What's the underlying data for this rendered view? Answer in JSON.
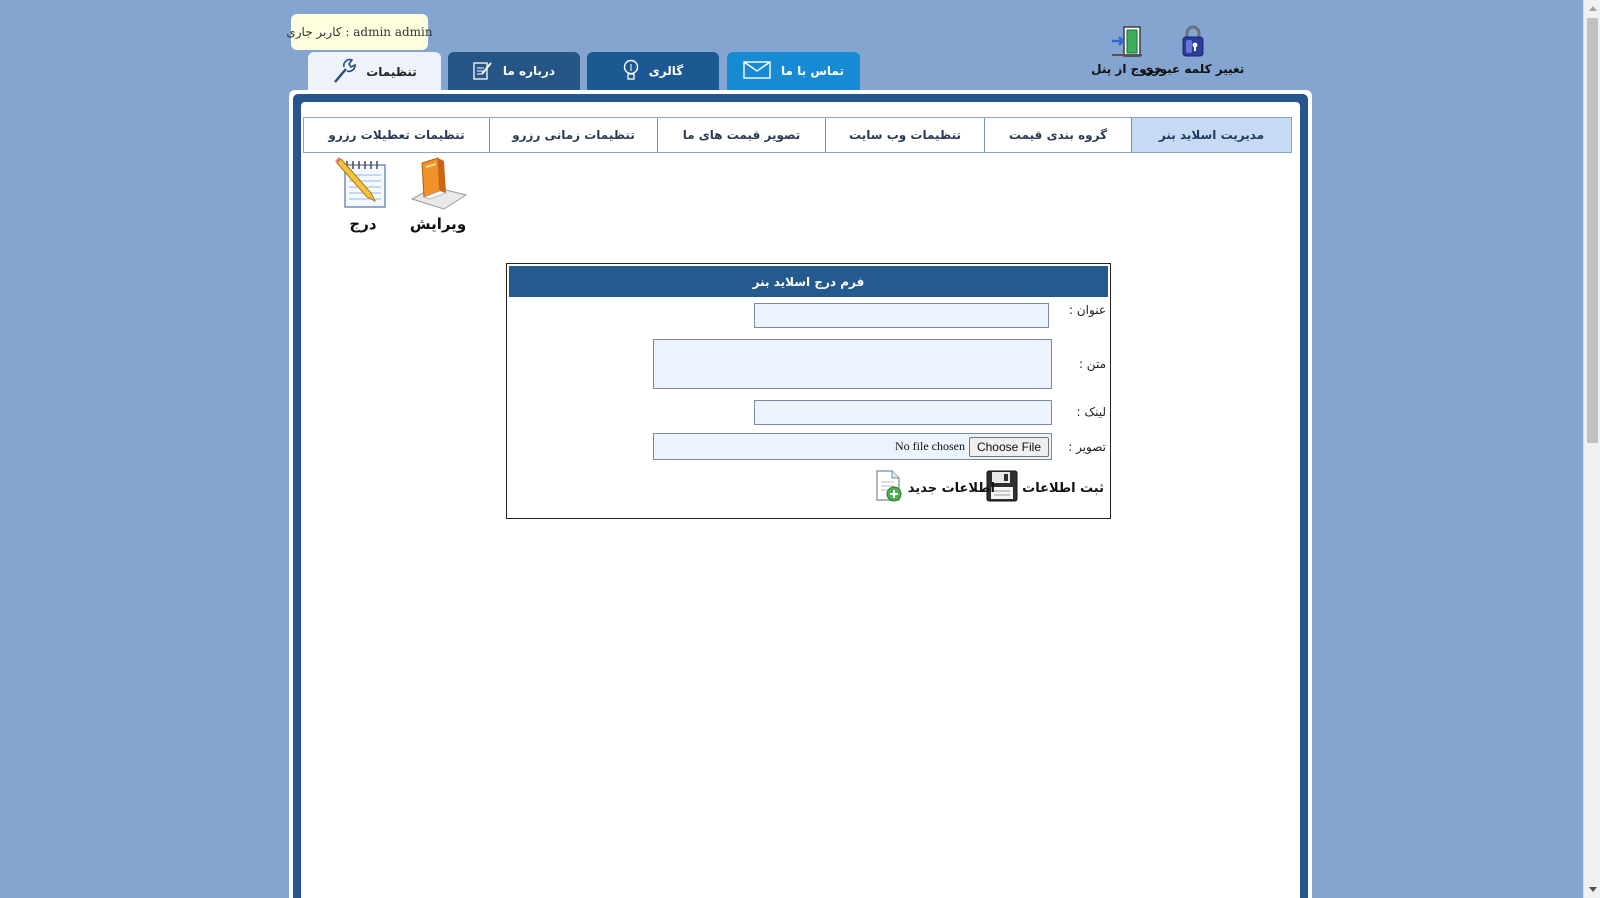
{
  "current_user": "admin admin : کاربر جاری",
  "top_actions": {
    "change_password": "تغییر کلمه عبوری",
    "exit_panel": "خروج از پنل"
  },
  "main_tabs": {
    "contact": "تماس با ما",
    "gallery": "گالری",
    "about": "درباره ما",
    "settings": "تنظیمات"
  },
  "sub_tabs": [
    "مدیریت اسلاید بنر",
    "گروه بندی قیمت",
    "تنظیمات وب سایت",
    "تصویر قیمت های ما",
    "تنظیمات زمانی رزرو",
    "تنظیمات تعطیلات رزرو"
  ],
  "tools": {
    "edit": "ویرایش",
    "insert": "درج"
  },
  "form": {
    "title": "فرم درج اسلاید بنر",
    "title_label": "عنوان :",
    "text_label": "متن :",
    "link_label": "لینک :",
    "image_label": "تصویر :",
    "title_value": "",
    "text_value": "",
    "link_value": "",
    "choose_file": "Choose File",
    "no_file": "No file chosen",
    "submit": "ثبت اطلاعات",
    "new_info": "اطلاعات جدید"
  },
  "colors": {
    "page_bg": "#84a5d0",
    "tab_dark": "#255d92",
    "tab_contact": "#168ad2",
    "header_blue": "#245a8d",
    "subtab_active": "#c6daf3",
    "input_bg": "#edf3fd"
  }
}
